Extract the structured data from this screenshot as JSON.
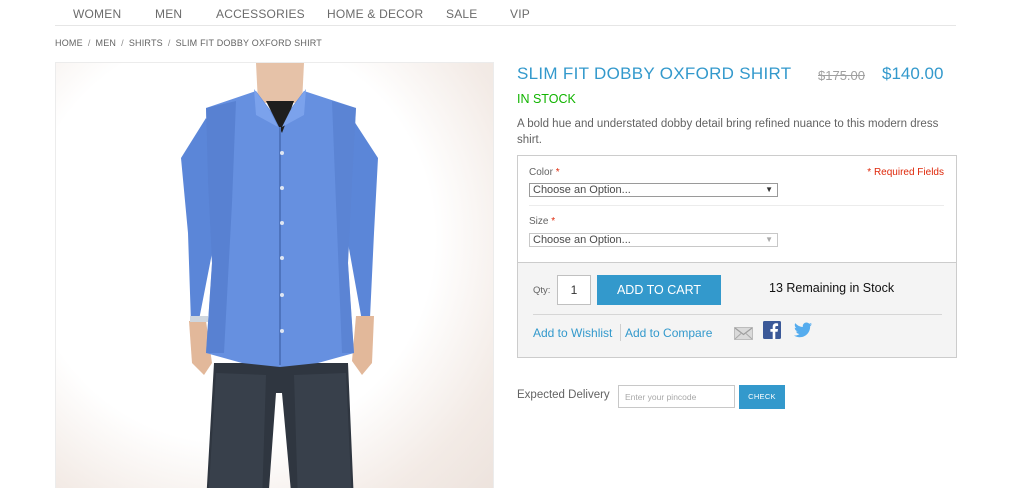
{
  "nav": {
    "items": [
      "WOMEN",
      "MEN",
      "ACCESSORIES",
      "HOME & DECOR",
      "SALE",
      "VIP"
    ]
  },
  "breadcrumb": {
    "items": [
      "HOME",
      "MEN",
      "SHIRTS"
    ],
    "separator": "/",
    "current": "SLIM FIT DOBBY OXFORD SHIRT"
  },
  "product": {
    "name": "SLIM FIT DOBBY OXFORD SHIRT",
    "old_price": "$175.00",
    "price": "$140.00",
    "availability": "IN STOCK",
    "description": "A bold hue and understated dobby detail bring refined nuance to this modern dress shirt.",
    "image_icon": "product-photo-blue-shirt"
  },
  "options": {
    "color_label": "Color",
    "size_label": "Size",
    "required_star": "*",
    "required_fields": "* Required Fields",
    "color_value": "Choose an Option...",
    "size_value": "Choose an Option..."
  },
  "cart": {
    "qty_label": "Qty:",
    "qty_value": "1",
    "add_to_cart": "ADD TO CART",
    "stock_remaining": "13 Remaining in Stock",
    "wishlist": "Add to Wishlist",
    "compare": "Add to Compare",
    "share_icons": [
      "email-icon",
      "facebook-icon",
      "twitter-icon"
    ]
  },
  "delivery": {
    "label": "Expected Delivery",
    "placeholder": "Enter your pincode",
    "check": "CHECK"
  },
  "colors": {
    "accent": "#3399cc",
    "in_stock": "#11b400",
    "required": "#df280a",
    "facebook": "#3b5998",
    "twitter": "#55acee"
  }
}
